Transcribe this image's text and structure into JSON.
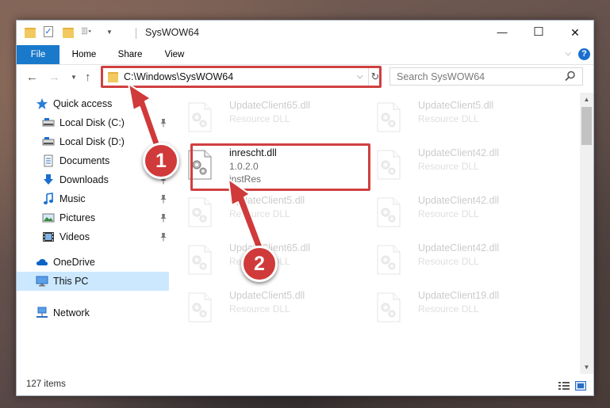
{
  "window": {
    "title": "SysWOW64",
    "minimize_glyph": "—",
    "maximize_glyph": "☐",
    "close_glyph": "✕"
  },
  "ribbon": {
    "tabs": [
      "File",
      "Home",
      "Share",
      "View"
    ],
    "help": "?",
    "accent": "#1979ca"
  },
  "address": {
    "path": "C:\\Windows\\SysWOW64",
    "search_placeholder": "Search SysWOW64"
  },
  "nav": {
    "items": [
      {
        "label": "Quick access",
        "icon": "star-icon"
      },
      {
        "label": "Local Disk (C:)",
        "icon": "drive-icon",
        "pinned": true
      },
      {
        "label": "Local Disk (D:)",
        "icon": "drive-icon"
      },
      {
        "label": "Documents",
        "icon": "documents-icon",
        "pinned": true
      },
      {
        "label": "Downloads",
        "icon": "download-icon",
        "pinned": true
      },
      {
        "label": "Music",
        "icon": "music-icon",
        "pinned": true
      },
      {
        "label": "Pictures",
        "icon": "pictures-icon",
        "pinned": true
      },
      {
        "label": "Videos",
        "icon": "videos-icon",
        "pinned": true
      },
      {
        "label": "OneDrive",
        "icon": "cloud-icon"
      },
      {
        "label": "This PC",
        "icon": "computer-icon",
        "selected": true
      },
      {
        "label": "Network",
        "icon": "network-icon"
      }
    ]
  },
  "files": [
    {
      "name": "UpdateClient65.dll",
      "sub1": "Resource DLL",
      "col": 0,
      "row": 0,
      "faded": true
    },
    {
      "name": "UpdateClient5.dll",
      "sub1": "Resource DLL",
      "col": 1,
      "row": 0,
      "faded": true
    },
    {
      "name": "inrescht.dll",
      "sub1": "1.0.2.0",
      "sub2": "instRes",
      "col": 0,
      "row": 1,
      "faded": false
    },
    {
      "name": "UpdateClient42.dll",
      "sub1": "Resource DLL",
      "col": 1,
      "row": 1,
      "faded": true
    },
    {
      "name": "UpdateClient5.dll",
      "sub1": "Resource DLL",
      "col": 0,
      "row": 2,
      "faded": true
    },
    {
      "name": "UpdateClient42.dll",
      "sub1": "Resource DLL",
      "col": 1,
      "row": 2,
      "faded": true
    },
    {
      "name": "UpdateClient65.dll",
      "sub1": "Resource DLL",
      "col": 0,
      "row": 3,
      "faded": true
    },
    {
      "name": "UpdateClient42.dll",
      "sub1": "Resource DLL",
      "col": 1,
      "row": 3,
      "faded": true
    },
    {
      "name": "UpdateClient5.dll",
      "sub1": "Resource DLL",
      "col": 0,
      "row": 4,
      "faded": true
    },
    {
      "name": "UpdateClient19.dll",
      "sub1": "Resource DLL",
      "col": 1,
      "row": 4,
      "faded": true
    }
  ],
  "status": {
    "item_count": "127 items"
  },
  "annotations": {
    "step1": "1",
    "step2": "2",
    "color": "#d03a3a"
  }
}
